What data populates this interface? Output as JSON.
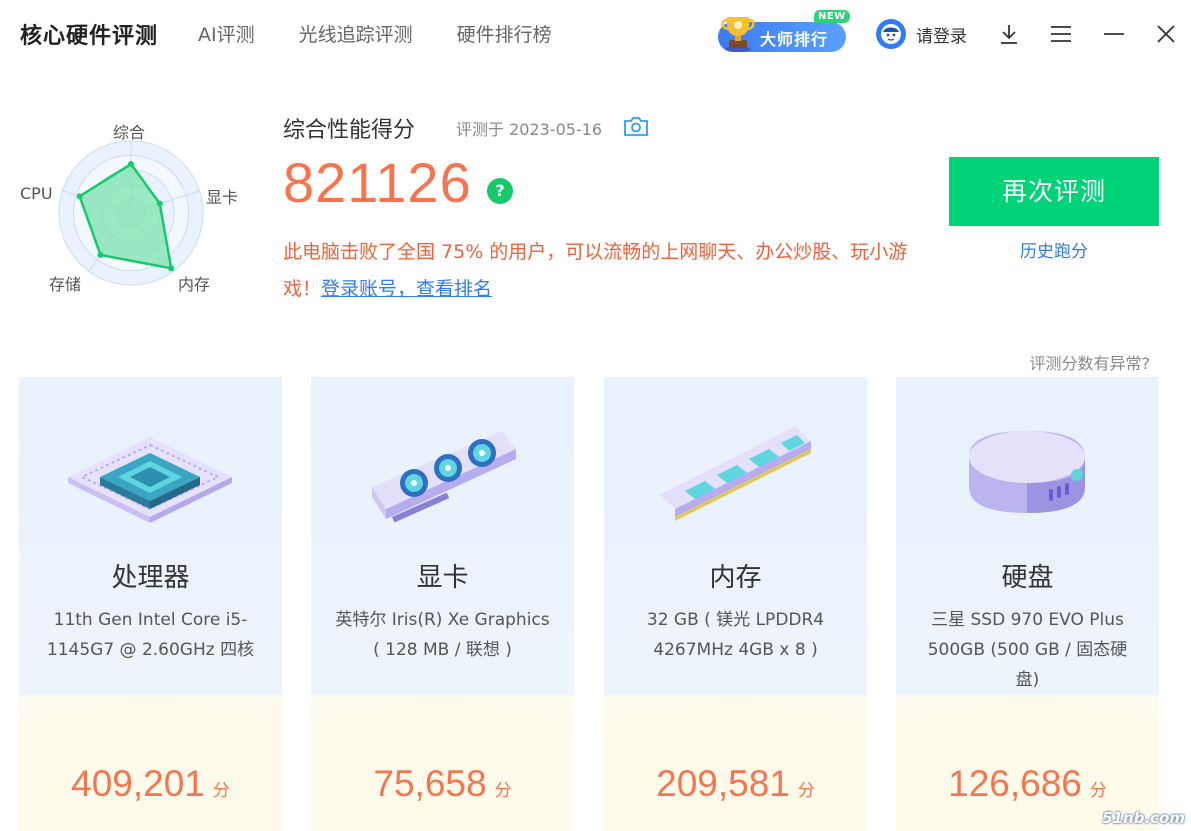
{
  "header": {
    "app_title": "核心硬件评测",
    "tabs": [
      {
        "label": "AI评测"
      },
      {
        "label": "光线追踪评测"
      },
      {
        "label": "硬件排行榜"
      }
    ],
    "master_badge": {
      "label": "大师排行",
      "tag": "NEW"
    },
    "login_label": "请登录"
  },
  "radar": {
    "axes": [
      "综合",
      "显卡",
      "内存",
      "存储",
      "CPU"
    ],
    "values": [
      0.68,
      0.42,
      0.95,
      0.72,
      0.75
    ],
    "fill_color": "#7ee3ad",
    "stroke_color": "#17c96a"
  },
  "score": {
    "title": "综合性能得分",
    "date_text": "评测于 2023-05-16",
    "value": "821126",
    "help_icon": "?",
    "description": "此电脑击败了全国 75% 的用户，可以流畅的上网聊天、办公炒股、玩小游戏！",
    "login_link": "登录账号，查看排名"
  },
  "actions": {
    "retest_label": "再次评测",
    "history_label": "历史跑分",
    "anomaly_label": "评测分数有异常?"
  },
  "cards": [
    {
      "name": "处理器",
      "desc": "11th Gen Intel Core i5-1145G7 @ 2.60GHz 四核",
      "score": "409,201",
      "unit": "分"
    },
    {
      "name": "显卡",
      "desc": "英特尔 Iris(R) Xe Graphics ( 128 MB / 联想 )",
      "score": "75,658",
      "unit": "分"
    },
    {
      "name": "内存",
      "desc": "32 GB ( 镁光 LPDDR4 4267MHz 4GB x 8 )",
      "score": "209,581",
      "unit": "分"
    },
    {
      "name": "硬盘",
      "desc": "三星 SSD 970 EVO Plus 500GB (500 GB / 固态硬盘)",
      "score": "126,686",
      "unit": "分"
    }
  ],
  "watermark": "51nb.com",
  "colors": {
    "accent_green": "#00d278",
    "score_orange": "#f47550",
    "link_blue": "#2f7cf6"
  }
}
